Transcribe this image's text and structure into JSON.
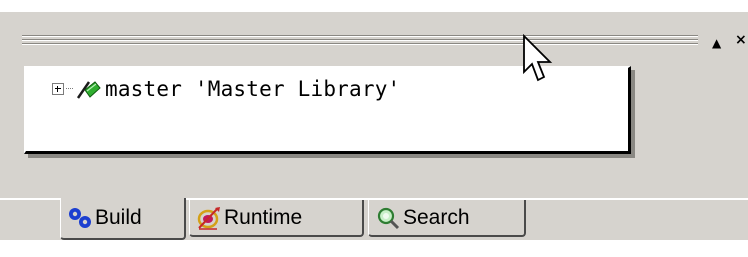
{
  "window": {
    "title_controls": {
      "restore_glyph": "▲",
      "close_glyph": "×"
    }
  },
  "tree": {
    "items": [
      {
        "label": "master 'Master Library'",
        "icon": "library-book-icon",
        "expanded": false
      }
    ]
  },
  "tabs": [
    {
      "label": "Build",
      "icon": "gears-icon",
      "active": true
    },
    {
      "label": "Runtime",
      "icon": "runtime-target-icon",
      "active": false
    },
    {
      "label": "Search",
      "icon": "magnifier-icon",
      "active": false
    }
  ],
  "colors": {
    "panel": "#d6d3ce",
    "tree_bg": "#ffffff",
    "build_icon": "#1c3fd0",
    "library_icon_green": "#2fae2f"
  }
}
